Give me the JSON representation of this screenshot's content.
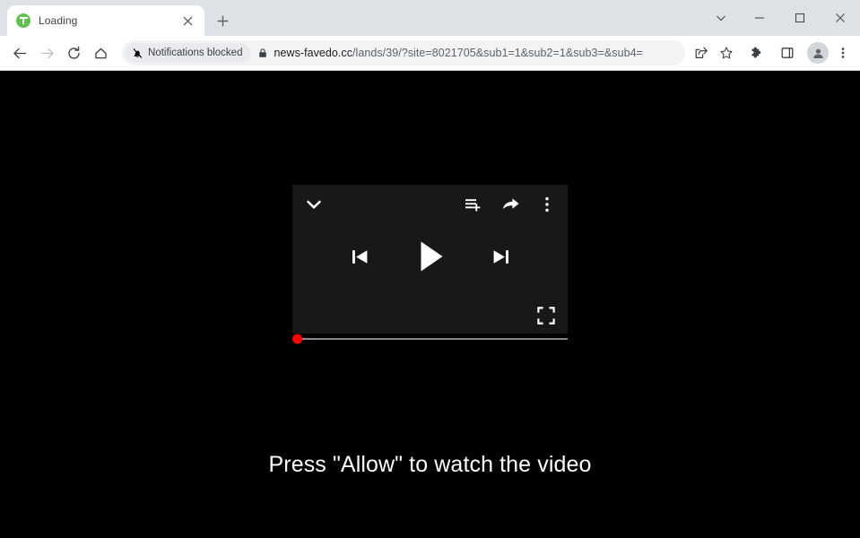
{
  "window": {
    "controls": {
      "tab_search": "tab-search-chevron",
      "minimize": "minimize",
      "maximize": "maximize",
      "close": "close"
    }
  },
  "tabstrip": {
    "tabs": [
      {
        "title": "Loading",
        "favicon": "green-circle-t-icon",
        "close_label": "×"
      }
    ],
    "new_tab_label": "+"
  },
  "toolbar": {
    "back_label": "back-arrow-icon",
    "forward_label": "forward-arrow-icon",
    "reload_label": "reload-icon",
    "home_label": "home-icon",
    "notifications": {
      "icon": "bell-slash-icon",
      "label": "Notifications blocked"
    },
    "security": {
      "icon": "lock-icon"
    },
    "url": {
      "host": "news-favedo.cc",
      "path": "/lands/39/?site=8021705&sub1=1&sub2=1&sub3=&sub4="
    },
    "actions": [
      {
        "name": "share-icon"
      },
      {
        "name": "bookmark-star-icon"
      },
      {
        "name": "extensions-puzzle-icon"
      },
      {
        "name": "side-panel-icon"
      },
      {
        "name": "profile-avatar-icon"
      },
      {
        "name": "chrome-menu-icon"
      }
    ]
  },
  "page": {
    "background_color": "#000000",
    "player": {
      "panel_color": "#181818",
      "topbar": {
        "collapse": "chevron-down-icon",
        "add_to_queue": "add-to-queue-icon",
        "share": "share-arrow-icon",
        "more": "more-vertical-icon"
      },
      "controls": {
        "previous": "previous-track-icon",
        "play": "play-icon",
        "next": "next-track-icon"
      },
      "fullscreen": "fullscreen-icon",
      "progress": {
        "value_percent": 0,
        "handle_color": "#ff0000",
        "track_color": "#8a8a8a"
      }
    },
    "message": "Press \"Allow\" to watch the video"
  }
}
